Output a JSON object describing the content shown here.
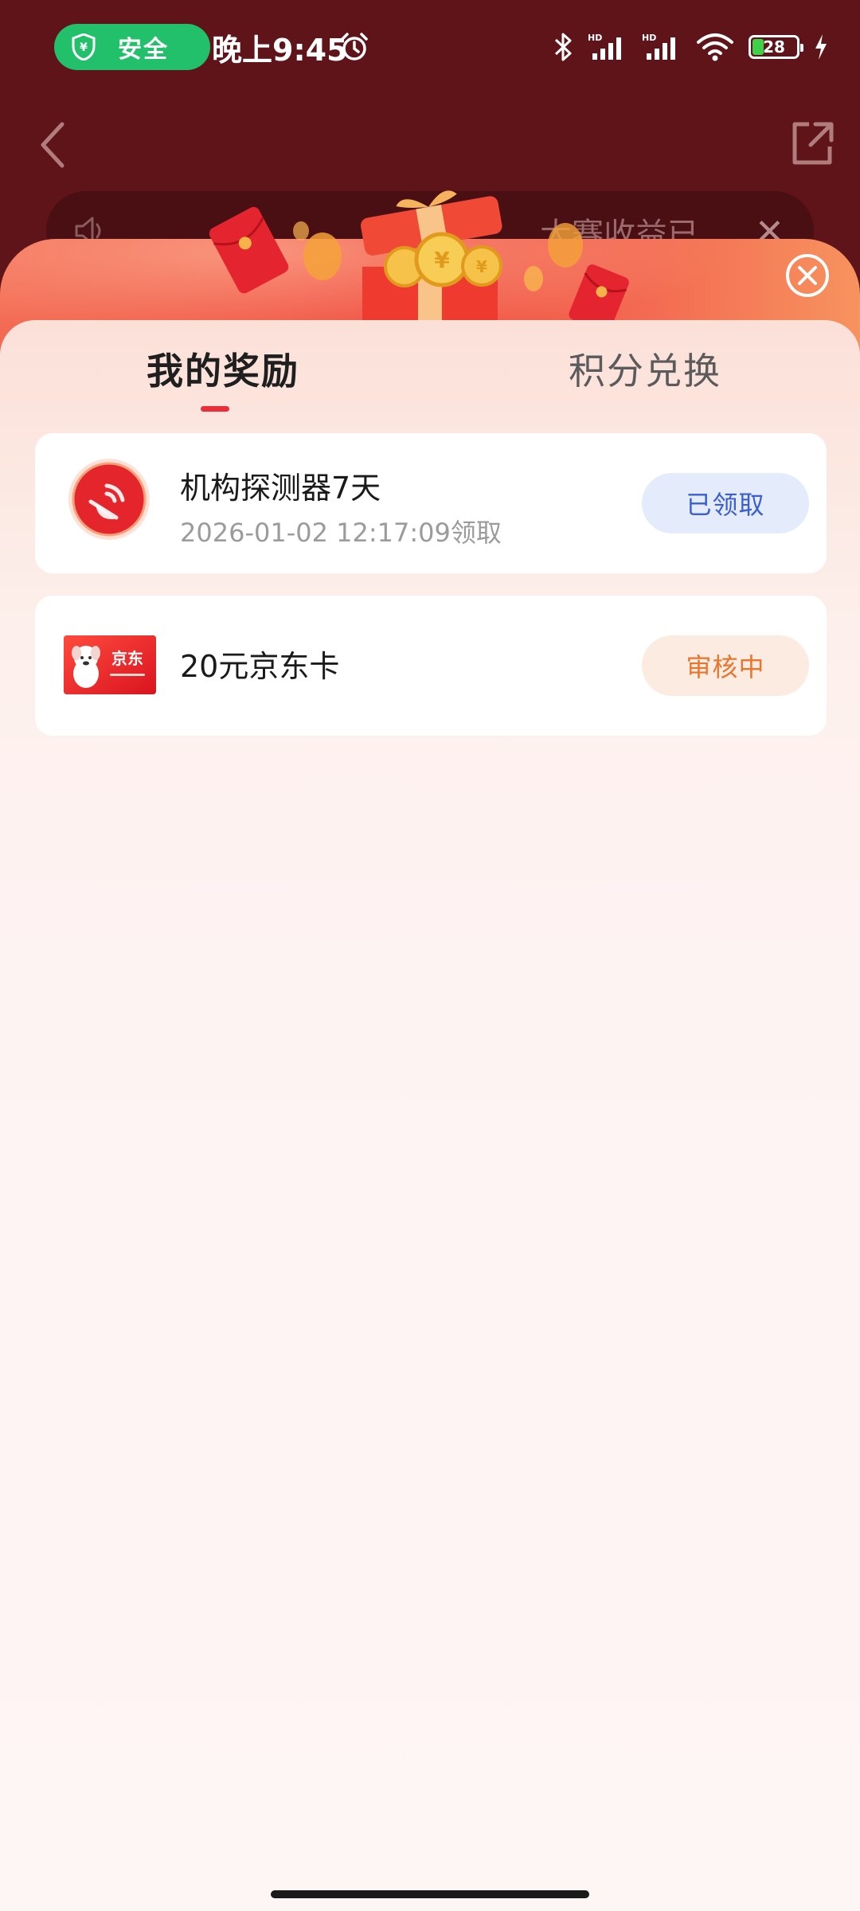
{
  "status_bar": {
    "security_label": "安全",
    "time": "晚上9:45",
    "battery_level": "28"
  },
  "background_page": {
    "notice_text": "大赛收益已"
  },
  "sheet": {
    "tabs": [
      {
        "label": "我的奖励",
        "active": true
      },
      {
        "label": "积分兑换",
        "active": false
      }
    ],
    "rewards": [
      {
        "title": "机构探测器7天",
        "subtitle": "2026-01-02 12:17:09领取",
        "status": "已领取",
        "icon": "detector-icon"
      },
      {
        "title": "20元京东卡",
        "subtitle": "",
        "status": "审核中",
        "icon": "jd-card-icon",
        "icon_text": "京东"
      }
    ]
  },
  "colors": {
    "background": "#5e1419",
    "accent_red": "#ea2f3b",
    "claimed_text": "#3b5fd0",
    "pending_text": "#e8762e",
    "security_green": "#22c06a"
  }
}
